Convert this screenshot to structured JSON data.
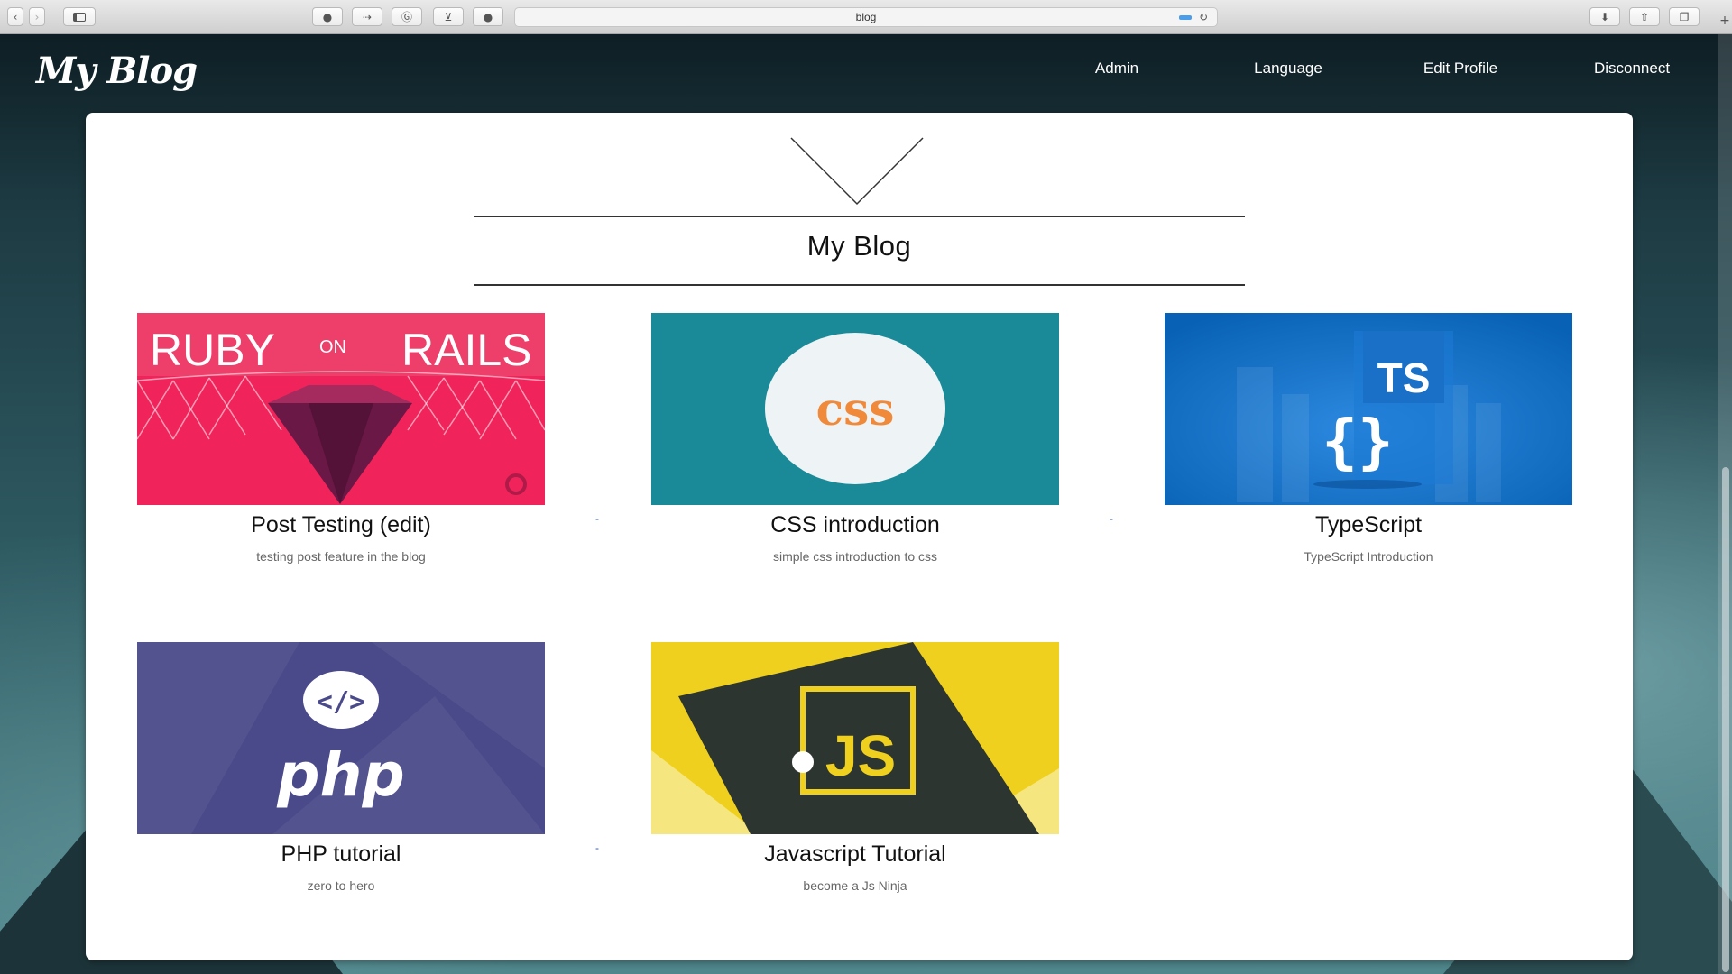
{
  "browser": {
    "url_text": "blog"
  },
  "site": {
    "logo": "My Blog",
    "nav": [
      {
        "label": "Admin"
      },
      {
        "label": "Language"
      },
      {
        "label": "Edit Profile"
      },
      {
        "label": "Disconnect"
      }
    ]
  },
  "main": {
    "title": "My Blog",
    "posts": [
      {
        "title": "Post Testing (edit)",
        "description": "testing post feature in the blog",
        "image": {
          "kind": "ruby-on-rails",
          "text_left": "RUBY",
          "text_mid": "ON",
          "text_right": "RAILS",
          "bg": "#f0245b"
        }
      },
      {
        "title": "CSS introduction",
        "description": "simple css introduction to css",
        "image": {
          "kind": "css",
          "text": "css",
          "bg": "#1a8a99",
          "text_color": "#f08a3a"
        }
      },
      {
        "title": "TypeScript",
        "description": "TypeScript Introduction",
        "image": {
          "kind": "typescript",
          "text": "TS",
          "braces": "{}",
          "bg": "#0c6fc4"
        }
      },
      {
        "title": "PHP tutorial",
        "description": "zero to hero",
        "image": {
          "kind": "php",
          "text": "php",
          "tag": "</>",
          "bg": "#4a4a8a"
        }
      },
      {
        "title": "Javascript Tutorial",
        "description": "become a Js Ninja",
        "image": {
          "kind": "javascript",
          "text": "JS",
          "bg": "#f0d01e"
        }
      }
    ],
    "separators": [
      "-",
      "-",
      "-"
    ]
  }
}
